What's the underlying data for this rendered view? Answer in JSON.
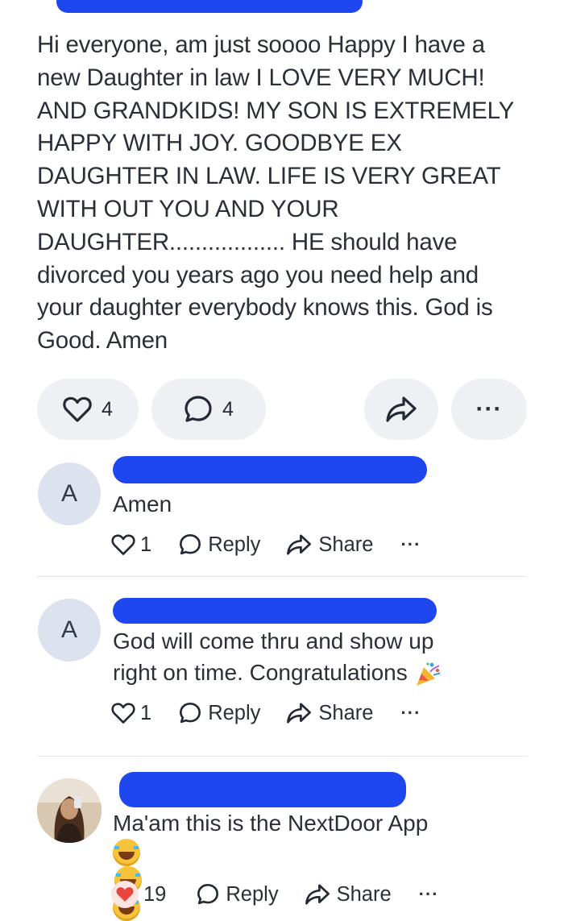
{
  "post": {
    "lines": [
      "Hi everyone, am just soooo Happy I have a",
      "new Daughter in law I LOVE VERY MUCH!",
      "AND GRANDKIDS! MY SON IS EXTREMELY",
      "HAPPY WITH JOY. GOODBYE EX",
      "DAUGHTER IN LAW. LIFE IS VERY GREAT",
      "WITH OUT YOU AND YOUR",
      "DAUGHTER.................. HE should have",
      "divorced you years ago you need help and",
      "your daughter everybody knows this. God is",
      "Good. Amen"
    ],
    "like_count": "4",
    "comment_count": "4"
  },
  "comments": [
    {
      "avatar_letter": "A",
      "lines": [
        "Amen"
      ],
      "like_count": "1",
      "reply_label": "Reply",
      "share_label": "Share",
      "more_label": "···"
    },
    {
      "avatar_letter": "A",
      "lines": [
        "God will come thru and show up",
        "right on time. Congratulations"
      ],
      "like_count": "1",
      "reply_label": "Reply",
      "share_label": "Share",
      "more_label": "···"
    },
    {
      "lines": [
        "Ma'am this is the NextDoor App"
      ],
      "like_count": "19",
      "reply_label": "Reply",
      "share_label": "Share",
      "more_label": "···"
    }
  ],
  "more_label": "···",
  "colors": {
    "redaction": "#1f47f0",
    "pill_bg": "#eef0f4",
    "avatar_bg": "#dde3ee",
    "heart_red": "#e8453c"
  }
}
